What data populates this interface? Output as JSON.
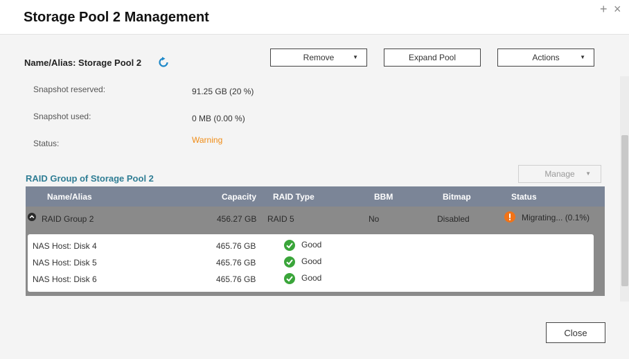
{
  "window": {
    "title": "Storage Pool 2 Management",
    "plus_glyph": "+",
    "close_glyph": "×"
  },
  "pool": {
    "name_alias": "Name/Alias: Storage Pool 2"
  },
  "toolbar": {
    "remove_label": "Remove",
    "expand_label": "Expand Pool",
    "actions_label": "Actions",
    "caret": "▼"
  },
  "info": [
    {
      "label": "Snapshot reserved:",
      "value": "91.25 GB (20 %)"
    },
    {
      "label": "Snapshot used:",
      "value": "0 MB (0.00 %)"
    },
    {
      "label": "Status:",
      "value": "Warning"
    }
  ],
  "raid_section": {
    "title": "RAID Group of Storage Pool 2",
    "manage_label": "Manage",
    "columns": [
      "Name/Alias",
      "Capacity",
      "RAID Type",
      "BBM",
      "Bitmap",
      "Status"
    ],
    "group": {
      "name": "RAID Group 2",
      "capacity": "456.27 GB",
      "raid_type": "RAID 5",
      "bbm": "No",
      "bitmap": "Disabled",
      "status": "Migrating... (0.1%)"
    },
    "disks": [
      {
        "name": "NAS Host: Disk 4",
        "capacity": "465.76 GB",
        "status": "Good"
      },
      {
        "name": "NAS Host: Disk 5",
        "capacity": "465.76 GB",
        "status": "Good"
      },
      {
        "name": "NAS Host: Disk 6",
        "capacity": "465.76 GB",
        "status": "Good"
      }
    ]
  },
  "footer": {
    "close_label": "Close"
  },
  "colors": {
    "warning": "#f08c16",
    "good": "#3aa53a",
    "accent": "#2f7d94",
    "header_bg": "#7b8597"
  },
  "icons": {
    "refresh": "refresh-icon",
    "toggle": "chevron-up-circle-icon",
    "warning": "warning-icon",
    "good": "check-circle-icon"
  }
}
